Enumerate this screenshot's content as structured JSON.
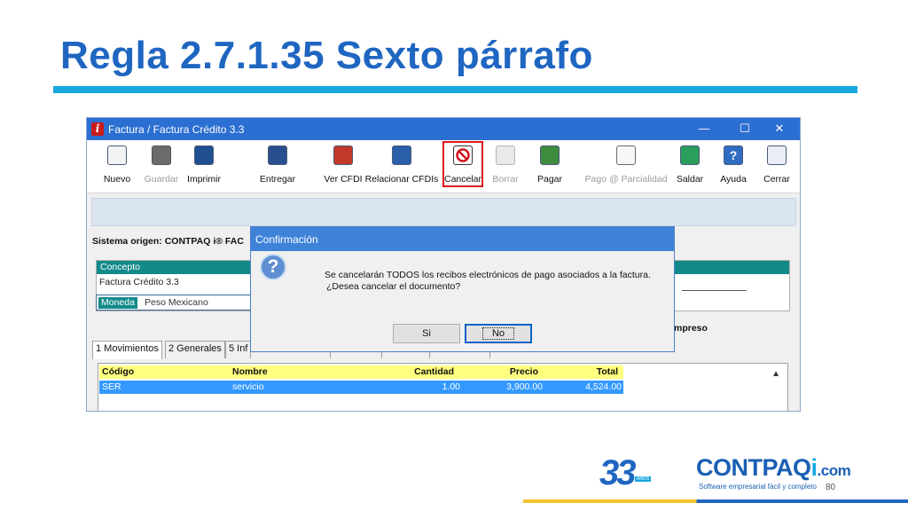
{
  "slide": {
    "title": "Regla 2.7.1.35 Sexto párrafo",
    "page_number": "80"
  },
  "window": {
    "title": "Factura / Factura Crédito 3.3",
    "app_icon": "i",
    "controls": [
      "—",
      "☐",
      "✕"
    ]
  },
  "toolbar": {
    "items": [
      {
        "label": "Nuevo",
        "icon": "new-document-icon",
        "enabled": true
      },
      {
        "label": "Guardar",
        "icon": "save-icon",
        "enabled": false
      },
      {
        "label": "Imprimir",
        "icon": "print-icon",
        "enabled": true
      },
      {
        "label": "Entregar",
        "icon": "deliver-icon",
        "enabled": true
      },
      {
        "label": "Ver CFDI",
        "icon": "view-cfdi-icon",
        "enabled": true
      },
      {
        "label": "Relacionar CFDIs",
        "icon": "relate-cfdi-icon",
        "enabled": true
      },
      {
        "label": "Cancelar",
        "icon": "cancel-icon",
        "enabled": true,
        "highlighted": true
      },
      {
        "label": "Borrar",
        "icon": "delete-icon",
        "enabled": false
      },
      {
        "label": "Pagar",
        "icon": "pay-icon",
        "enabled": true
      },
      {
        "label": "Pago @ Parcialidad",
        "icon": "partial-payment-icon",
        "enabled": false
      },
      {
        "label": "Saldar",
        "icon": "settle-icon",
        "enabled": true
      },
      {
        "label": "Ayuda",
        "icon": "help-icon",
        "enabled": true
      },
      {
        "label": "Cerrar",
        "icon": "close-exit-icon",
        "enabled": true
      }
    ]
  },
  "form": {
    "origin_label": "Sistema origen: CONTPAQ i® FAC",
    "concepto_header": "Concepto",
    "concepto_value": "Factura Crédito 3.3",
    "moneda_label": "Moneda",
    "moneda_value": "Peso Mexicano",
    "status_fragment": "mpreso"
  },
  "tabs": [
    {
      "label": "1 Movimientos",
      "active": true
    },
    {
      "label": "2 Generales",
      "active": false
    },
    {
      "label": "5 Inf",
      "active": false
    }
  ],
  "grid": {
    "columns": [
      "Código",
      "Nombre",
      "Cantidad",
      "Precio",
      "Total"
    ],
    "rows": [
      {
        "codigo": "SER",
        "nombre": "servicio",
        "cantidad": "1.00",
        "precio": "3,900.00",
        "total": "4,524.00"
      }
    ],
    "scroll_icon": "▲"
  },
  "dialog": {
    "title": "Confirmación",
    "icon": "?",
    "message_line1": "Se cancelarán TODOS los recibos electrónicos de pago asociados a la factura.",
    "message_line2": "¿Desea cancelar el documento?",
    "yes_label": "Si",
    "no_label": "No"
  },
  "footer": {
    "anniversary": "33",
    "anniversary_sub": "AÑOS",
    "brand": "CONTPAQ",
    "brand_i": "i",
    "brand_suffix": ".com",
    "tagline": "Software empresarial fácil y completo"
  },
  "colors": {
    "title": "#1f66c1",
    "rule": "#19a7e0",
    "titlebar": "#2b6fd2",
    "highlight": "#e0181e",
    "teal": "#138a8a",
    "selection": "#3399ff",
    "grid_header": "#ffff7f"
  }
}
